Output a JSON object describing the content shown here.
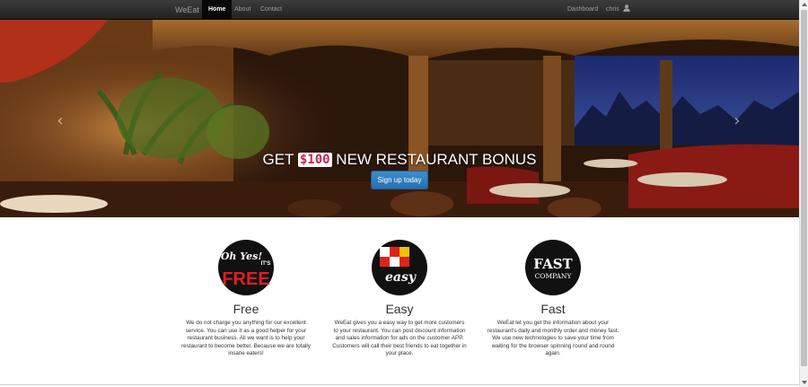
{
  "navbar": {
    "brand": "WeEat",
    "links": [
      {
        "label": "Home",
        "active": true
      },
      {
        "label": "About",
        "active": false
      },
      {
        "label": "Contact",
        "active": false
      }
    ],
    "right": {
      "dashboard": "Dashboard",
      "user": "chris",
      "user_icon": "user-icon"
    }
  },
  "hero": {
    "caption_before": "GET ",
    "caption_amount": "$100",
    "caption_after": " NEW RESTAURANT BONUS",
    "button_label": "Sign up today",
    "prev_icon": "chevron-left-icon",
    "next_icon": "chevron-right-icon"
  },
  "features": [
    {
      "logo_text_top": "Oh Yes!",
      "logo_text_side": "IT'S",
      "logo_text_main": "FREE",
      "title": "Free",
      "text": "We do not charge you anything for our excellent service. You can use it as a good helper for your restaurant business. All we want is to help your restaurant to become better. Because we are totally insane eaters!"
    },
    {
      "logo_text_main": "easy",
      "title": "Easy",
      "text": "WeEat gives you a easy way to get more customers to your restaurant. You can post discount information and sales information for ads on the customer APP. Customers will call their best friends to eat together in your place."
    },
    {
      "logo_text_top": "FAST",
      "logo_text_main": "COMPANY",
      "title": "Fast",
      "text": "WeEat let you get the information about your restaurant's daily and monthly order and money fast. We use new technologies to save your time from waiting for the browser spinning round and round again."
    }
  ],
  "colors": {
    "navbar": "#222222",
    "button": "#337ab7",
    "badge_text": "#c7254e"
  }
}
